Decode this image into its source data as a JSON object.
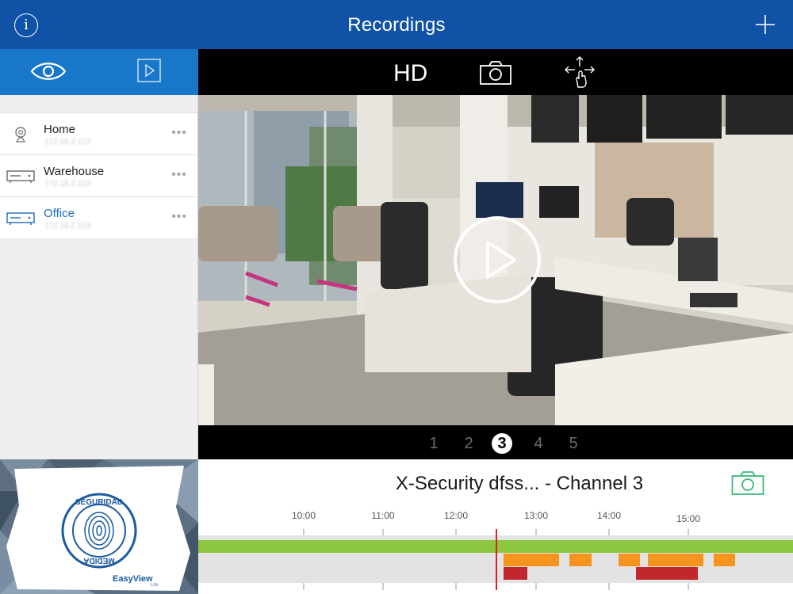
{
  "header": {
    "title": "Recordings",
    "info_glyph": "i"
  },
  "sidebar": {
    "devices": [
      {
        "name": "Home",
        "ip": "172.18.2.123",
        "icon": "camera-icon",
        "more": "•••",
        "active": false
      },
      {
        "name": "Warehouse",
        "ip": "172.18.2.123",
        "icon": "dvr-icon",
        "more": "•••",
        "active": false
      },
      {
        "name": "Office",
        "ip": "172.18.2.123",
        "icon": "dvr-icon",
        "more": "•••",
        "active": true
      }
    ]
  },
  "branding": {
    "seal_top": "SEGURIDAD",
    "seal_bottom": "MEDIDA",
    "brand": "EasyView",
    "brand_sub": "Lite"
  },
  "toolbar": {
    "quality": "HD"
  },
  "channels": {
    "numbers": [
      "1",
      "2",
      "3",
      "4",
      "5"
    ],
    "active": "3"
  },
  "timeline": {
    "title": "X-Security dfss... - Channel 3",
    "ticks": [
      "10:00",
      "11:00",
      "12:00",
      "13:00",
      "14:00",
      "15:00"
    ],
    "cursor_time": "12:35",
    "colors": {
      "continuous": "#8dc63f",
      "motion": "#f7941d",
      "alarm": "#c1272d",
      "cursor": "#e02020",
      "accent": "#1053a6",
      "snapshot_icon": "#3cb878"
    }
  }
}
